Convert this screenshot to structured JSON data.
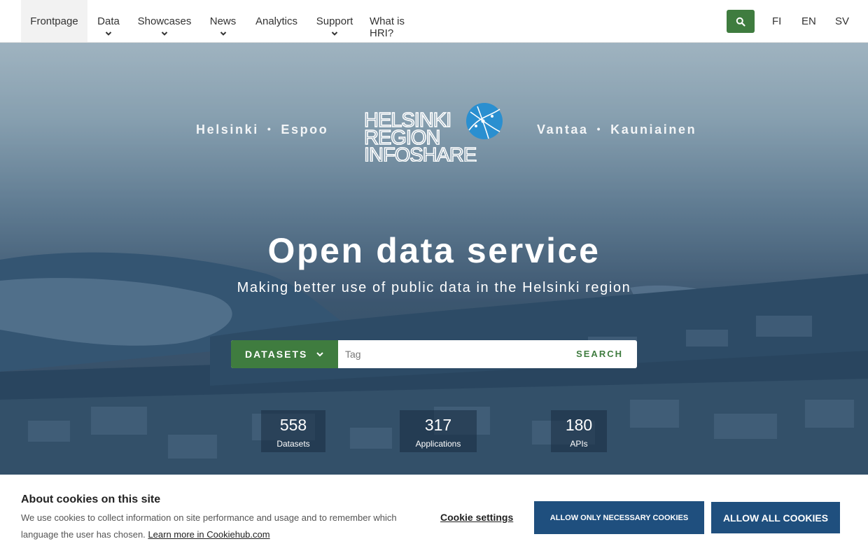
{
  "nav": {
    "items": [
      {
        "label": "Frontpage"
      },
      {
        "label": "Data"
      },
      {
        "label": "Showcases"
      },
      {
        "label": "News"
      },
      {
        "label": "Analytics"
      },
      {
        "label": "Support"
      },
      {
        "label": "What is HRI?"
      }
    ],
    "languages": [
      "FI",
      "EN",
      "SV"
    ]
  },
  "hero": {
    "cities_left": [
      "Helsinki",
      "Espoo"
    ],
    "cities_right": [
      "Vantaa",
      "Kauniainen"
    ],
    "logo_lines": [
      "HELSINKI",
      "REGION",
      "INFOSHARE"
    ],
    "title": "Open data service",
    "subtitle": "Making better use of public data in the Helsinki region",
    "search": {
      "category": "DATASETS",
      "placeholder": "Tag",
      "button": "SEARCH"
    },
    "stats": [
      {
        "value": "558",
        "label": "Datasets"
      },
      {
        "value": "317",
        "label": "Applications"
      },
      {
        "value": "180",
        "label": "APIs"
      }
    ]
  },
  "cookie": {
    "title": "About cookies on this site",
    "text": "We use cookies to collect information on site performance and usage and to remember which language the user has chosen.",
    "learn_more": "Learn more in Cookiehub.com",
    "settings": "Cookie settings",
    "necessary": "ALLOW ONLY NECESSARY COOKIES",
    "all": "ALLOW ALL COOKIES"
  },
  "colors": {
    "accent_green": "#3f7c3f",
    "cookie_blue": "#1f4f7e"
  }
}
